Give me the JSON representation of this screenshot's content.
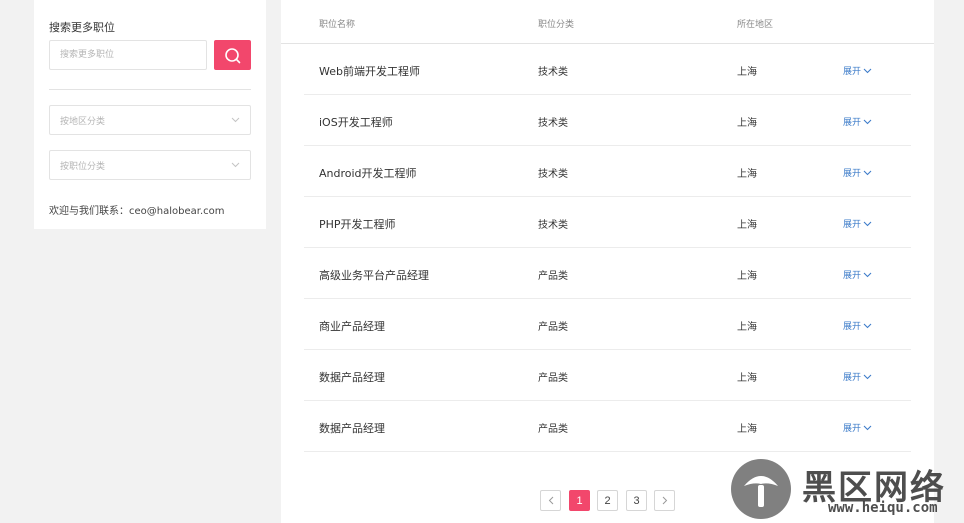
{
  "sidebar": {
    "title": "搜索更多职位",
    "search_placeholder": "搜索更多职位",
    "region_select": "按地区分类",
    "category_select": "按职位分类",
    "contact": "欢迎与我们联系：ceo@halobear.com"
  },
  "table": {
    "headers": [
      "职位名称",
      "职位分类",
      "所在地区"
    ],
    "expand_label": "展开",
    "rows": [
      {
        "title": "Web前端开发工程师",
        "category": "技术类",
        "location": "上海"
      },
      {
        "title": "iOS开发工程师",
        "category": "技术类",
        "location": "上海"
      },
      {
        "title": "Android开发工程师",
        "category": "技术类",
        "location": "上海"
      },
      {
        "title": "PHP开发工程师",
        "category": "技术类",
        "location": "上海"
      },
      {
        "title": "高级业务平台产品经理",
        "category": "产品类",
        "location": "上海"
      },
      {
        "title": "商业产品经理",
        "category": "产品类",
        "location": "上海"
      },
      {
        "title": "数据产品经理",
        "category": "产品类",
        "location": "上海"
      },
      {
        "title": "数据产品经理",
        "category": "产品类",
        "location": "上海"
      }
    ]
  },
  "pagination": {
    "pages": [
      "1",
      "2",
      "3"
    ],
    "current": "1"
  },
  "watermark": {
    "text": "黑区网络",
    "url": "www.heiqu.com"
  },
  "colors": {
    "accent": "#f2476c",
    "link": "#3d7cc9"
  }
}
